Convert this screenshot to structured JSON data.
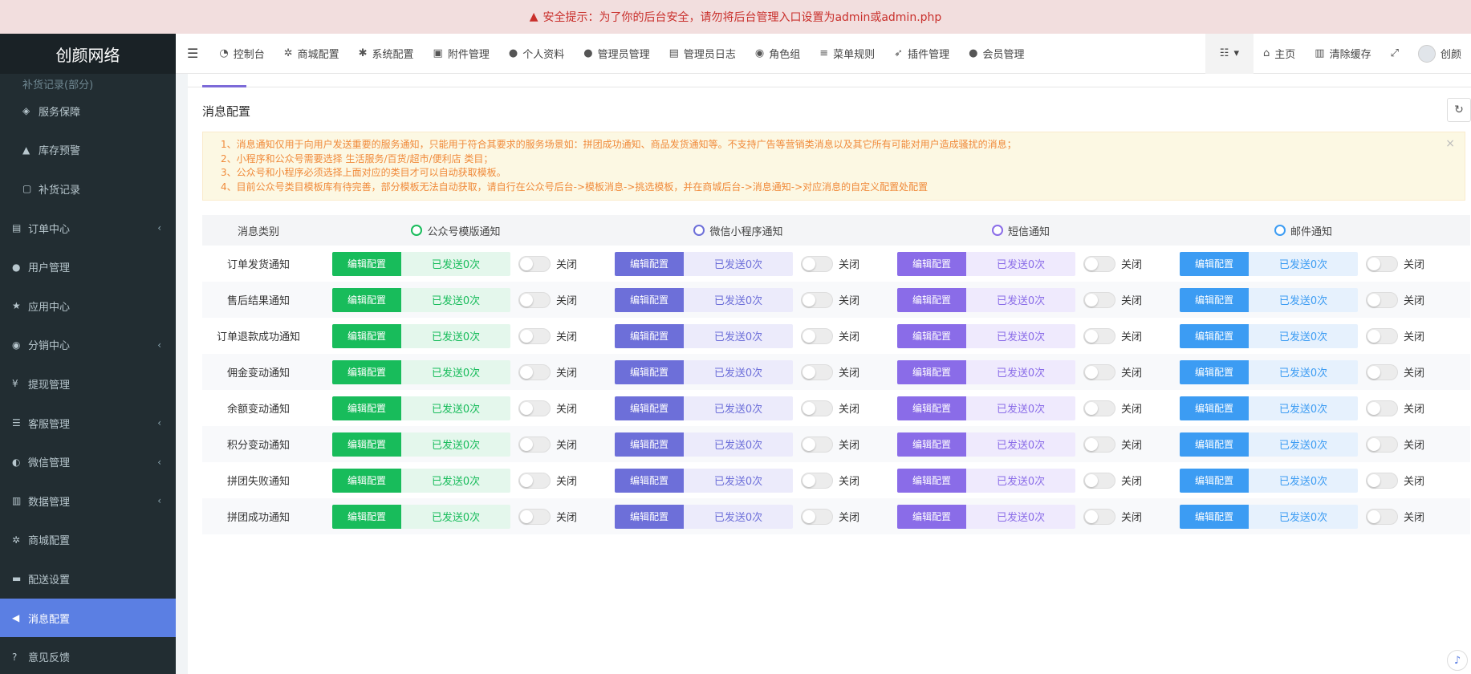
{
  "alert": {
    "text": "安全提示：为了你的后台安全，请勿将后台管理入口设置为admin或admin.php",
    "icon": "warning-icon"
  },
  "brand": "创颜网络",
  "sidebar": {
    "items": [
      {
        "label": "补货记录(部分)",
        "icon": "",
        "chevron": false,
        "sub": true,
        "cut": true
      },
      {
        "label": "服务保障",
        "icon": "tag-icon",
        "chevron": false,
        "sub": true
      },
      {
        "label": "库存预警",
        "icon": "warning-icon",
        "chevron": false,
        "sub": true
      },
      {
        "label": "补货记录",
        "icon": "square-icon",
        "chevron": false,
        "sub": true
      },
      {
        "label": "订单中心",
        "icon": "file-icon",
        "chevron": true
      },
      {
        "label": "用户管理",
        "icon": "user-icon",
        "chevron": false
      },
      {
        "label": "应用中心",
        "icon": "star-icon",
        "chevron": false
      },
      {
        "label": "分销中心",
        "icon": "users-icon",
        "chevron": true
      },
      {
        "label": "提现管理",
        "icon": "yen-icon",
        "chevron": false
      },
      {
        "label": "客服管理",
        "icon": "list-icon",
        "chevron": true
      },
      {
        "label": "微信管理",
        "icon": "wechat-icon",
        "chevron": true
      },
      {
        "label": "数据管理",
        "icon": "chart-icon",
        "chevron": true
      },
      {
        "label": "商城配置",
        "icon": "gears-icon",
        "chevron": false
      },
      {
        "label": "配送设置",
        "icon": "car-icon",
        "chevron": false
      },
      {
        "label": "消息配置",
        "icon": "bullhorn-icon",
        "chevron": false,
        "active": true
      },
      {
        "label": "意见反馈",
        "icon": "question-icon",
        "chevron": false
      }
    ]
  },
  "topnav": {
    "items": [
      {
        "label": "控制台",
        "icon": "dashboard-icon"
      },
      {
        "label": "商城配置",
        "icon": "gears-icon"
      },
      {
        "label": "系统配置",
        "icon": "gear-icon"
      },
      {
        "label": "附件管理",
        "icon": "image-file-icon"
      },
      {
        "label": "个人资料",
        "icon": "user-icon"
      },
      {
        "label": "管理员管理",
        "icon": "user-icon"
      },
      {
        "label": "管理员日志",
        "icon": "list-alt-icon"
      },
      {
        "label": "角色组",
        "icon": "group-icon"
      },
      {
        "label": "菜单规则",
        "icon": "bars-icon"
      },
      {
        "label": "插件管理",
        "icon": "rocket-icon"
      },
      {
        "label": "会员管理",
        "icon": "user-icon"
      }
    ],
    "right": [
      {
        "label": "主页",
        "icon": "home-icon"
      },
      {
        "label": "清除缓存",
        "icon": "trash-icon"
      }
    ],
    "username": "创颜"
  },
  "panel": {
    "title": "消息配置",
    "notice": [
      "1、消息通知仅用于向用户发送重要的服务通知，只能用于符合其要求的服务场景如：拼团成功通知、商品发货通知等。不支持广告等营销类消息以及其它所有可能对用户造成骚扰的消息；",
      "2、小程序和公众号需要选择 生活服务/百货/超市/便利店 类目；",
      "3、公众号和小程序必须选择上面对应的类目才可以自动获取模板。",
      "4、目前公众号类目模板库有待完善，部分模板无法自动获取，请自行在公众号后台->模板消息->挑选模板，并在商城后台->消息通知->对应消息的自定义配置处配置"
    ]
  },
  "table": {
    "category_header": "消息类别",
    "channels": [
      {
        "name": "公众号模版通知",
        "style": "green",
        "icon": "wechat-mp-icon",
        "color": "#18bc5b"
      },
      {
        "name": "微信小程序通知",
        "style": "indigo",
        "icon": "miniprogram-icon",
        "color": "#6d6fd9"
      },
      {
        "name": "短信通知",
        "style": "purple",
        "icon": "sms-icon",
        "color": "#8a6ce8"
      },
      {
        "name": "邮件通知",
        "style": "blue",
        "icon": "mail-icon",
        "color": "#3c9cf3"
      }
    ],
    "edit_label": "编辑配置",
    "toggle_label": "关闭",
    "rows": [
      {
        "name": "订单发货通知",
        "counts": [
          "已发送0次",
          "已发送0次",
          "已发送0次",
          "已发送0次"
        ]
      },
      {
        "name": "售后结果通知",
        "counts": [
          "已发送0次",
          "已发送0次",
          "已发送0次",
          "已发送0次"
        ]
      },
      {
        "name": "订单退款成功通知",
        "counts": [
          "已发送0次",
          "已发送0次",
          "已发送0次",
          "已发送0次"
        ]
      },
      {
        "name": "佣金变动通知",
        "counts": [
          "已发送0次",
          "已发送0次",
          "已发送0次",
          "已发送0次"
        ]
      },
      {
        "name": "余额变动通知",
        "counts": [
          "已发送0次",
          "已发送0次",
          "已发送0次",
          "已发送0次"
        ]
      },
      {
        "name": "积分变动通知",
        "counts": [
          "已发送0次",
          "已发送0次",
          "已发送0次",
          "已发送0次"
        ]
      },
      {
        "name": "拼团失败通知",
        "counts": [
          "已发送0次",
          "已发送0次",
          "已发送0次",
          "已发送0次"
        ]
      },
      {
        "name": "拼团成功通知",
        "counts": [
          "已发送0次",
          "已发送0次",
          "已发送0次",
          "已发送0次"
        ]
      }
    ]
  }
}
